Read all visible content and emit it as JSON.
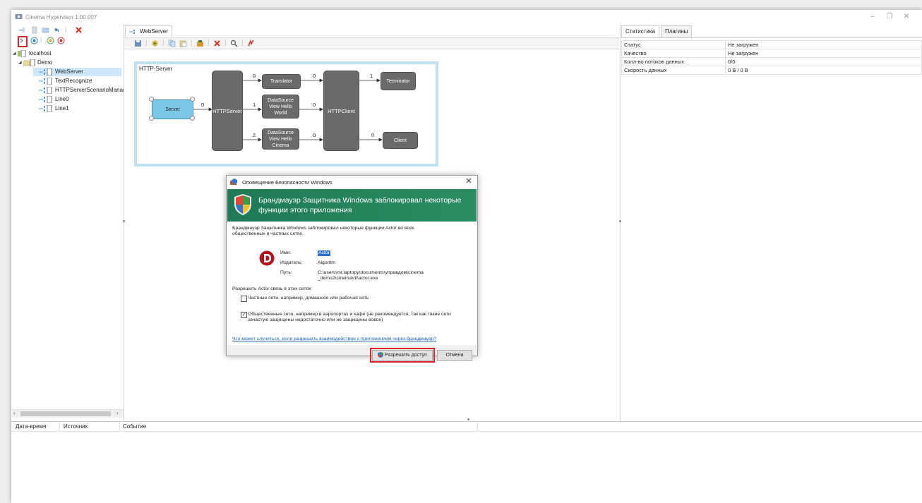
{
  "window": {
    "title": "Cinema Hypervisor 1.00.007",
    "controls": {
      "minimize": "–",
      "restore": "❐",
      "close": "✕"
    }
  },
  "tree": {
    "items": [
      {
        "label": "localhost",
        "level": 0
      },
      {
        "label": "Demo",
        "level": 1
      },
      {
        "label": "WebServer",
        "level": 2,
        "selected": true
      },
      {
        "label": "TextRecognize",
        "level": 2
      },
      {
        "label": "HTTPServerScenarioManag",
        "level": 2
      },
      {
        "label": "Line0",
        "level": 2
      },
      {
        "label": "Line1",
        "level": 2
      }
    ]
  },
  "editor": {
    "tab": "WebServer",
    "diagram": {
      "title": "HTTP-Server",
      "nodes": {
        "server": "Server",
        "httpserver": "HTTPServer",
        "translator": "Translator",
        "ds1": "DataSource View Hello World",
        "ds2": "DataSource View Hello Cinema",
        "httpclient": "HTTPClient",
        "terminator": "Terminator",
        "client": "Client"
      },
      "edges": {
        "server_http": "0",
        "http_translator": "0",
        "http_ds1": "1",
        "http_ds2": "2",
        "translator_client": "0",
        "ds1_client": "0",
        "ds2_client": "0",
        "client_terminator": "1",
        "client_client": "0"
      }
    }
  },
  "properties": {
    "tabs": [
      "Статистика",
      "Плагины"
    ],
    "rows": [
      {
        "key": "Статус",
        "value": "Не загружен"
      },
      {
        "key": "Качество",
        "value": "Не загружен"
      },
      {
        "key": "Колл-во потоков данных",
        "value": "0/0"
      },
      {
        "key": "Скорость данных",
        "value": "0 B / 0 B"
      }
    ]
  },
  "log": {
    "columns": [
      "Дата-время",
      "Источник",
      "Событие"
    ]
  },
  "dialog": {
    "title": "Оповещение Безопасности Windows",
    "banner": "Брандмауэр Защитника Windows заблокировал некоторые функции этого приложения",
    "intro": "Брандмауэр Защитника Windows заблокировал некоторые функции Actor во всех общественных и частных сетях.",
    "name_label": "Имя:",
    "name_value": "Actor",
    "publisher_label": "Издатель:",
    "publisher_value": "Algoritm",
    "path_label": "Путь:",
    "path_value": "C:\\users\\mr.laptopy\\documents\\управдом\\cinema_demo2\\cinema\\rtl\\actor.exe",
    "allow_prompt": "Разрешить Actor связь в этих сетях:",
    "private_label": "Частные сети, например, домашняя или рабочая сеть",
    "private_checked": false,
    "public_label": "Общественные сети, например в аэропортах и кафе (не рекомендуется, так как такие сети зачастую защищены недостаточно или не защищены вовсе)",
    "public_checked": true,
    "link": "Что может случиться, если разрешить взаимодействие с приложением через брандмауэр?",
    "allow_button": "Разрешить доступ",
    "cancel_button": "Отмена",
    "highlight_color": "#d9262c",
    "banner_color": "#237f59"
  }
}
